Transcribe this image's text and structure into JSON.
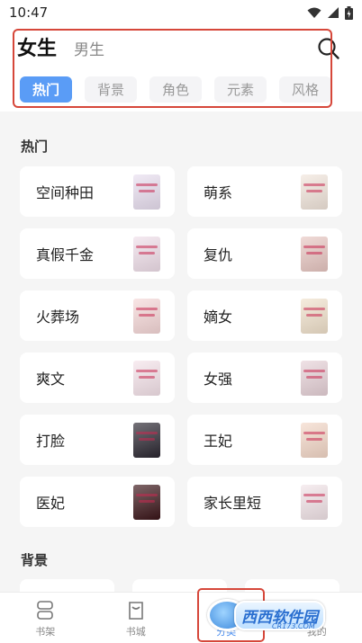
{
  "status_bar": {
    "time": "10:47"
  },
  "header": {
    "tabs": [
      {
        "label": "女生",
        "active": true
      },
      {
        "label": "男生",
        "active": false
      }
    ],
    "filters": [
      {
        "label": "热门",
        "active": true
      },
      {
        "label": "背景",
        "active": false
      },
      {
        "label": "角色",
        "active": false
      },
      {
        "label": "元素",
        "active": false
      },
      {
        "label": "风格",
        "active": false
      }
    ],
    "search_icon": "search-icon"
  },
  "sections": [
    {
      "title": "热门",
      "items": [
        {
          "label": "空间种田",
          "cover_color": "#e9dff0"
        },
        {
          "label": "萌系",
          "cover_color": "#f2e6dc"
        },
        {
          "label": "真假千金",
          "cover_color": "#f0dfea"
        },
        {
          "label": "复仇",
          "cover_color": "#e8c7c2"
        },
        {
          "label": "火葬场",
          "cover_color": "#f6d8d8"
        },
        {
          "label": "嫡女",
          "cover_color": "#f1e2cc"
        },
        {
          "label": "爽文",
          "cover_color": "#f5e3ea"
        },
        {
          "label": "女强",
          "cover_color": "#e7d2d8"
        },
        {
          "label": "打脸",
          "cover_color": "#2a2630"
        },
        {
          "label": "王妃",
          "cover_color": "#f4d8c8"
        },
        {
          "label": "医妃",
          "cover_color": "#3a1418"
        },
        {
          "label": "家长里短",
          "cover_color": "#f2e4e8"
        }
      ]
    },
    {
      "title": "背景"
    }
  ],
  "bottom_nav": [
    {
      "label": "书架",
      "icon": "bookshelf-icon",
      "active": false
    },
    {
      "label": "书城",
      "icon": "bookstore-icon",
      "active": false
    },
    {
      "label": "分类",
      "icon": "category-icon",
      "active": true
    },
    {
      "label": "我的",
      "icon": "profile-icon",
      "active": false
    }
  ],
  "watermark": {
    "text": "西西软件园",
    "sub": "CR173.COM"
  },
  "colors": {
    "accent": "#5a9cf6",
    "highlight": "#d6473a"
  }
}
